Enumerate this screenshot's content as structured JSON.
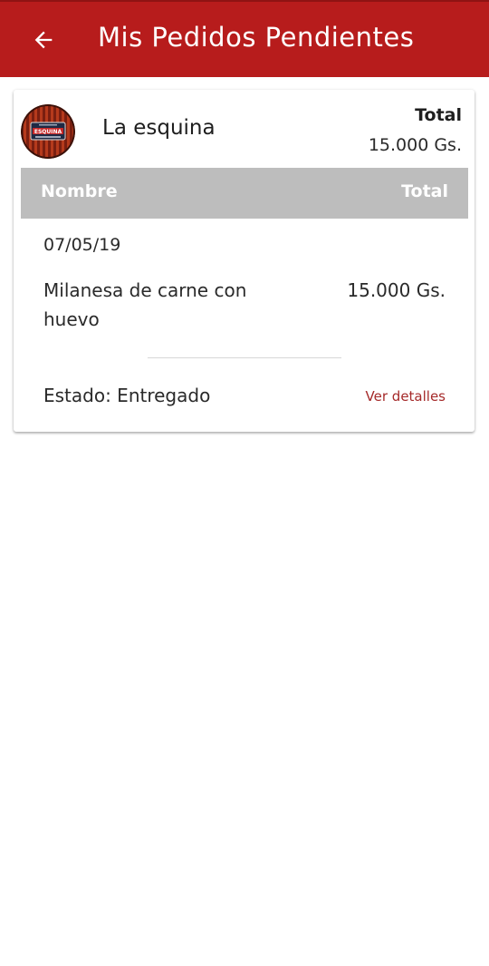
{
  "header": {
    "title": "Mis Pedidos Pendientes",
    "back_icon": "arrow-back-icon",
    "background_color": "#b71c1c"
  },
  "order": {
    "store_name": "La esquina",
    "store_logo": {
      "text": "ESQUINA",
      "icon": "store-logo"
    },
    "total_label": "Total",
    "total_value": "15.000 Gs.",
    "table_header": {
      "name_label": "Nombre",
      "total_label": "Total",
      "background_color": "#bdbdbd"
    },
    "date": "07/05/19",
    "items": [
      {
        "name": "Milanesa de carne con huevo",
        "price": "15.000 Gs."
      }
    ],
    "status": "Estado: Entregado",
    "details_link": "Ver detalles",
    "link_color": "#a52a2a"
  }
}
